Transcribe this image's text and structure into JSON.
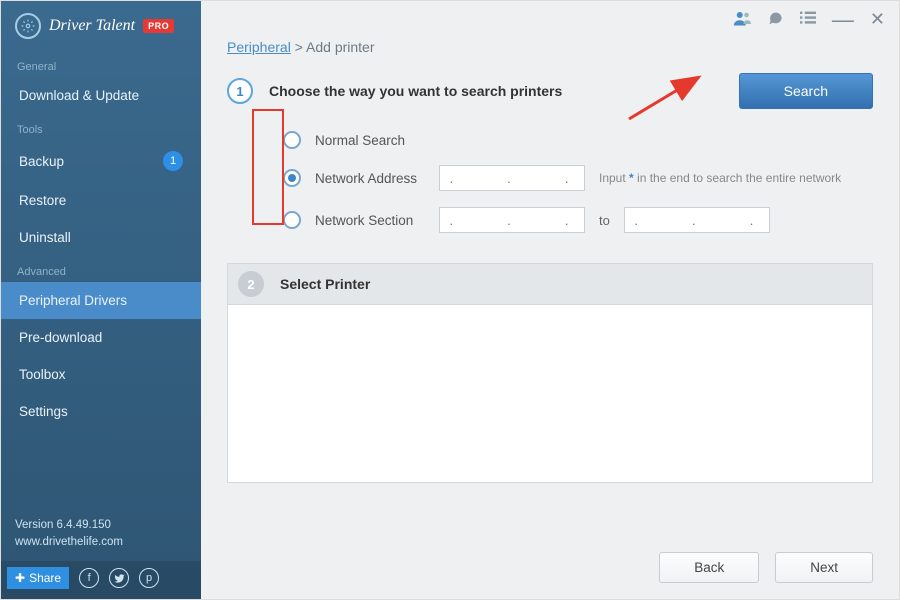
{
  "app": {
    "name": "Driver Talent",
    "pro_badge": "PRO"
  },
  "sidebar": {
    "sections": {
      "general": {
        "label": "General",
        "items": [
          {
            "label": "Download & Update",
            "badge": null
          }
        ]
      },
      "tools": {
        "label": "Tools",
        "items": [
          {
            "label": "Backup",
            "badge": "1"
          },
          {
            "label": "Restore",
            "badge": null
          },
          {
            "label": "Uninstall",
            "badge": null
          }
        ]
      },
      "advanced": {
        "label": "Advanced",
        "items": [
          {
            "label": "Peripheral Drivers",
            "badge": null,
            "active": true
          },
          {
            "label": "Pre-download",
            "badge": null
          },
          {
            "label": "Toolbox",
            "badge": null
          },
          {
            "label": "Settings",
            "badge": null
          }
        ]
      }
    },
    "version": "Version 6.4.49.150",
    "website": "www.drivethelife.com",
    "share_label": "Share"
  },
  "breadcrumb": {
    "link": "Peripheral",
    "sep": " > ",
    "current": "Add printer"
  },
  "step1": {
    "num": "1",
    "title": "Choose the way you want to search printers",
    "search_btn": "Search",
    "options": {
      "normal": "Normal Search",
      "network_addr": "Network Address",
      "network_sect": "Network Section"
    },
    "ip_placeholder": ".     .     .",
    "hint_prefix": "Input ",
    "hint_star": "*",
    "hint_suffix": " in the end to search the entire network",
    "to": "to"
  },
  "step2": {
    "num": "2",
    "title": "Select Printer"
  },
  "footer": {
    "back": "Back",
    "next": "Next"
  },
  "titlebar": {
    "user_icon": "user",
    "chat_icon": "chat",
    "list_icon": "list",
    "min_icon": "minimize",
    "close_icon": "close"
  }
}
